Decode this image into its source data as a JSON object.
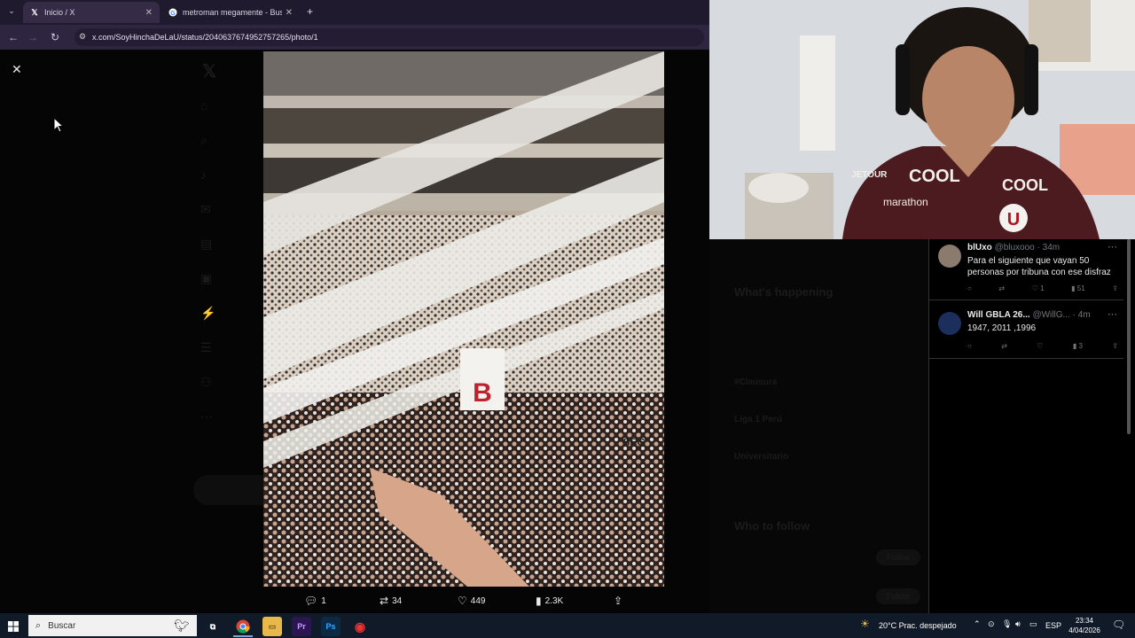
{
  "tabs": [
    {
      "title": "Inicio / X",
      "close": "✕"
    },
    {
      "title": "metroman megamente - Busca",
      "close": "✕"
    }
  ],
  "new_tab": "+",
  "url": "x.com/SoyHinchaDeLaU/status/2040637674952757265/photo/1",
  "close_viewer": "✕",
  "photo_letter": "B",
  "photo_shirt": "SEG",
  "post_actions": {
    "replies": "1",
    "reposts": "34",
    "likes": "449",
    "views": "2.3K"
  },
  "right_sidebar_dim": {
    "heading": "What's happening",
    "trend1": "#Clausura",
    "trend2": "Liga 1 Perú",
    "trend3": "Universitario",
    "who_to_follow": "Who to follow",
    "follow": "Follow"
  },
  "webcam_shirt": {
    "brand1": "COOL",
    "brand2": "COOL",
    "sponsor": "marathon",
    "sleeve": "JETOUR",
    "crest": "U"
  },
  "replies": [
    {
      "name": "blUxo",
      "handle": "@bluxooo · 34m",
      "text": "Para el siguiente que vayan 50 personas por tribuna con ese disfraz",
      "likes": "1",
      "views": "51"
    },
    {
      "name": "Will GBLA 26...",
      "handle": "@WillG... · 4m",
      "text": "1947, 2011 ,1996",
      "views": "3"
    }
  ],
  "taskbar": {
    "search_placeholder": "Buscar",
    "weather": "20°C  Prac. despejado",
    "lang": "ESP",
    "time": "23:34",
    "date": "4/04/2026"
  },
  "colors": {
    "accent": "#1d9bf0",
    "chrome_dark": "#1f1a2e"
  }
}
